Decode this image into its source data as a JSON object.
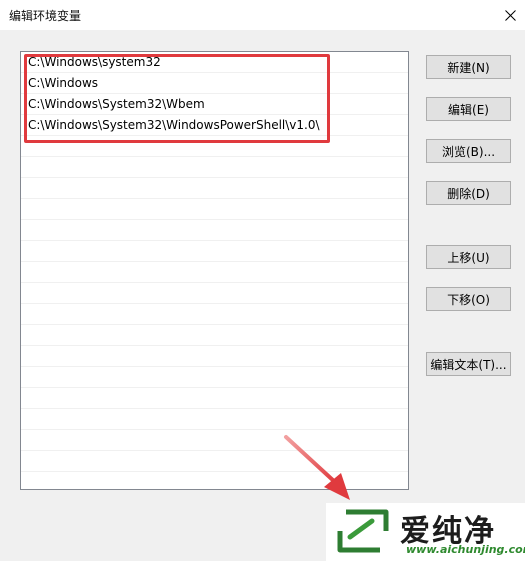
{
  "window": {
    "title": "编辑环境变量",
    "close_glyph": "✕"
  },
  "paths": [
    "C:\\Windows\\system32",
    "C:\\Windows",
    "C:\\Windows\\System32\\Wbem",
    "C:\\Windows\\System32\\WindowsPowerShell\\v1.0\\"
  ],
  "buttons": {
    "new": "新建(N)",
    "edit": "编辑(E)",
    "browse": "浏览(B)...",
    "delete": "删除(D)",
    "move_up": "上移(U)",
    "move_down": "下移(O)",
    "edit_text": "编辑文本(T)..."
  },
  "watermark": {
    "brand": "爱纯净",
    "url": "www.aichunjing.com"
  },
  "colors": {
    "highlight": "#e03a3e",
    "watermark_green": "#3a9a3a"
  }
}
